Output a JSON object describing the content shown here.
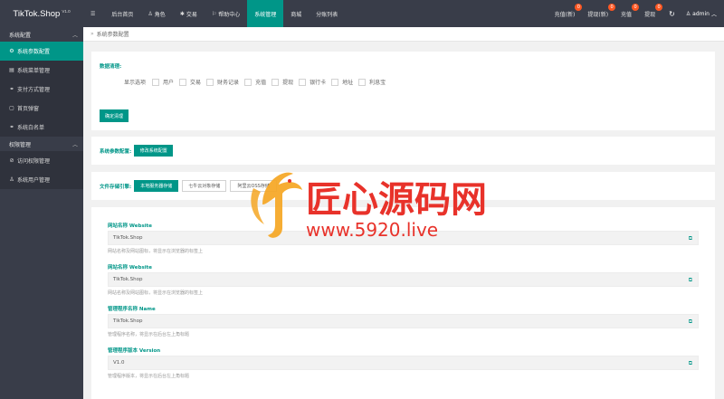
{
  "brand": {
    "title": "TikTok.Shop",
    "version": "V1.0"
  },
  "nav": {
    "items": [
      {
        "icon": "menu",
        "label": ""
      },
      {
        "icon": "",
        "label": "后台首页"
      },
      {
        "icon": "user",
        "label": "角色"
      },
      {
        "icon": "transaction",
        "label": "交易"
      },
      {
        "icon": "flag",
        "label": "帮助中心"
      },
      {
        "icon": "",
        "label": "系统管理",
        "active": true
      },
      {
        "icon": "",
        "label": "商城"
      },
      {
        "icon": "",
        "label": "分账列表"
      }
    ],
    "right": [
      {
        "label": "充值(新)",
        "badge": "0"
      },
      {
        "label": "提现(新)",
        "badge": "0"
      },
      {
        "label": "充值",
        "badge": "0"
      },
      {
        "label": "提现",
        "badge": "0"
      }
    ],
    "admin_label": "admin"
  },
  "sidebar": {
    "group1": "系统配置",
    "items1": [
      {
        "icon": "gear",
        "label": "系统参数配置",
        "active": true
      },
      {
        "icon": "list",
        "label": "系统菜单管理"
      },
      {
        "icon": "link",
        "label": "支付方式管理"
      },
      {
        "icon": "square",
        "label": "首页弹窗"
      },
      {
        "icon": "link",
        "label": "系统白名单"
      }
    ],
    "group2": "权限管理",
    "items2": [
      {
        "icon": "check",
        "label": "访问权限管理"
      },
      {
        "icon": "user",
        "label": "系统用户管理"
      }
    ]
  },
  "breadcrumb": {
    "sep": "»",
    "text": "系统参数配置"
  },
  "card1": {
    "title": "数据清理:",
    "lead": "显示选项",
    "checks": [
      "用户",
      "交易",
      "财务记录",
      "充值",
      "提现",
      "银行卡",
      "地址",
      "利息宝"
    ],
    "button": "确定清理"
  },
  "card2": {
    "label": "系统参数配置:",
    "button": "修改系统配置"
  },
  "card3": {
    "label": "文件存储引擎:",
    "buttons": [
      "本地服务器存储",
      "七牛云对象存储",
      "阿里云OSS存储"
    ]
  },
  "fields": [
    {
      "label": "网站名称 Website",
      "value": "TikTok.Shop",
      "hint": "网站名称及网站图标，将显示在浏览器的标签上"
    },
    {
      "label": "网站名称 Website",
      "value": "TikTok.Shop",
      "hint": "网站名称及网站图标，将显示在浏览器的标签上"
    },
    {
      "label": "管理程序名称 Name",
      "value": "TikTok.Shop",
      "hint": "管理程序名称，将显示在后台左上角标题"
    },
    {
      "label": "管理程序版本 Version",
      "value": "V1.0",
      "hint": "管理程序版本，将显示在后台左上角标题"
    }
  ],
  "watermark": {
    "name": "匠心源码网",
    "url": "www.5920.live",
    "orange": "#f5a623",
    "red": "#e8322a"
  },
  "colors": {
    "primary": "#009688",
    "topbar": "#393d49",
    "badge": "#ff5722"
  }
}
